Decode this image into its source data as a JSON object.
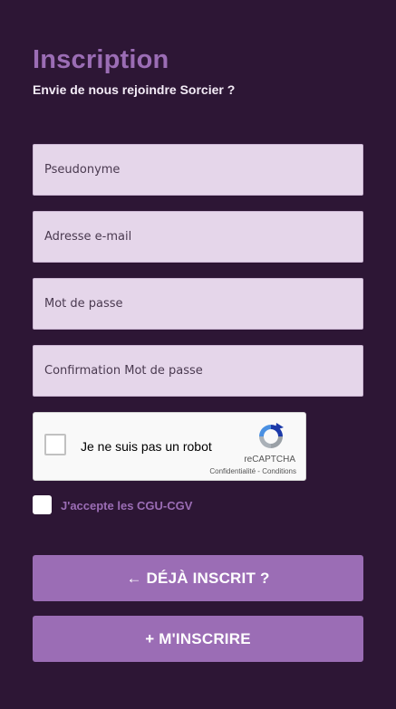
{
  "header": {
    "title": "Inscription",
    "subtitle": "Envie de nous rejoindre Sorcier ?"
  },
  "form": {
    "pseudonyme_placeholder": "Pseudonyme",
    "email_placeholder": "Adresse e-mail",
    "password_placeholder": "Mot de passe",
    "confirm_password_placeholder": "Confirmation Mot de passe"
  },
  "recaptcha": {
    "label": "Je ne suis pas un robot",
    "brand": "reCAPTCHA",
    "privacy": "Confidentialité",
    "separator": " - ",
    "terms": "Conditions",
    "icon": "recaptcha-logo-icon"
  },
  "cgu": {
    "label": "J'accepte les CGU-CGV"
  },
  "buttons": {
    "already_registered": "← DÉJÀ INSCRIT ?",
    "register": "+ M'INSCRIRE"
  },
  "colors": {
    "background": "#2d1635",
    "accent": "#9b6db5",
    "field_bg": "#e5d6ea"
  }
}
